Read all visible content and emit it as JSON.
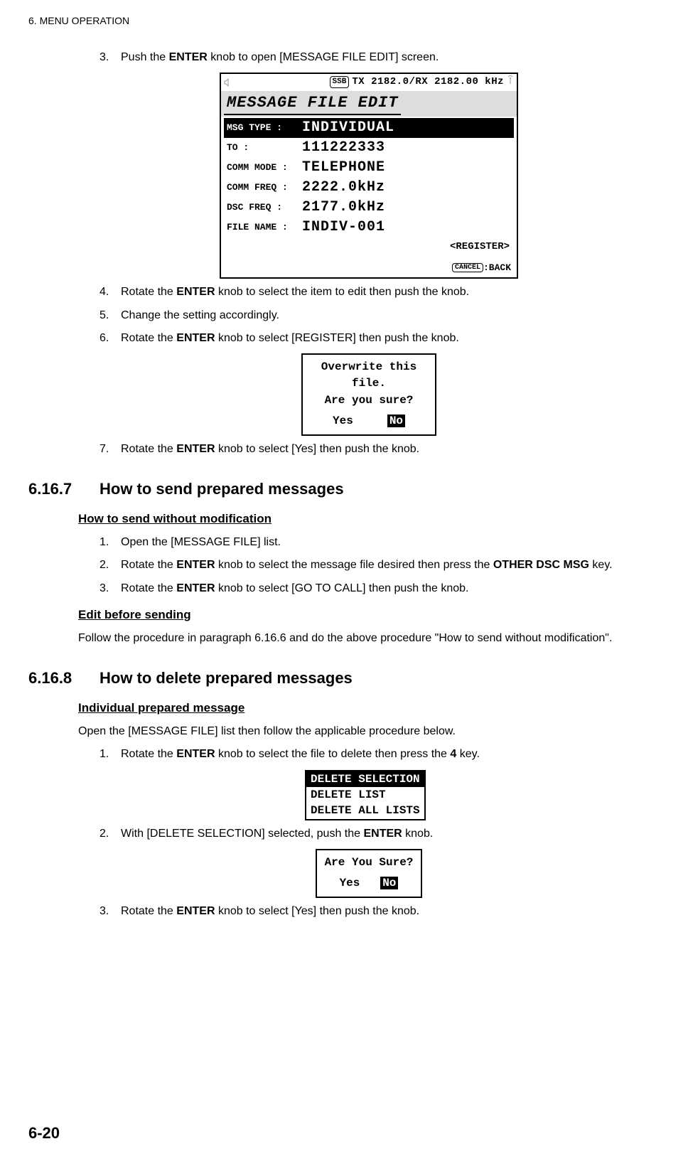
{
  "pageHeader": "6.  MENU OPERATION",
  "step3": {
    "num": "3.",
    "prefix": "Push the ",
    "bold1": "ENTER",
    "suffix": " knob to open [MESSAGE FILE EDIT] screen."
  },
  "screenEdit": {
    "ssb": "SSB",
    "freq": "TX 2182.0/RX 2182.00 kHz",
    "title": "MESSAGE FILE  EDIT",
    "rows": {
      "msgType": {
        "label": "MSG TYPE  :",
        "val": "INDIVIDUAL"
      },
      "to": {
        "label": "TO        :",
        "val": "111222333"
      },
      "commMode": {
        "label": "COMM MODE :",
        "val": "TELEPHONE"
      },
      "commFreq": {
        "label": "COMM FREQ :",
        "val": " 2222.0kHz"
      },
      "dscFreq": {
        "label": "DSC  FREQ :",
        "val": " 2177.0kHz"
      },
      "fileName": {
        "label": "FILE NAME :",
        "val": "INDIV-001"
      }
    },
    "register": "<REGISTER>",
    "cancel": "CANCEL",
    "back": ":BACK"
  },
  "step4": {
    "num": "4.",
    "prefix": "Rotate the ",
    "bold1": "ENTER",
    "suffix": " knob to select the item to edit then push the knob."
  },
  "step5": {
    "num": "5.",
    "text": "Change the setting accordingly."
  },
  "step6": {
    "num": "6.",
    "prefix": "Rotate the ",
    "bold1": "ENTER",
    "suffix": " knob to select [REGISTER] then push the knob."
  },
  "dialog1": {
    "l1": "Overwrite this file.",
    "l2": "Are you sure?",
    "yes": "Yes",
    "no": "No"
  },
  "step7": {
    "num": "7.",
    "prefix": "Rotate the ",
    "bold1": "ENTER",
    "suffix": " knob to select [Yes] then push the knob."
  },
  "section_6_16_7": {
    "num": "6.16.7",
    "title": "How to send prepared messages",
    "sub1": "How to send without modification",
    "s1": {
      "num": "1.",
      "text": "Open the [MESSAGE FILE] list."
    },
    "s2": {
      "num": "2.",
      "prefix": "Rotate the ",
      "bold1": "ENTER",
      "mid": " knob to select the message file desired then press the ",
      "bold2": "OTHER DSC MSG",
      "suffix": " key."
    },
    "s3": {
      "num": "3.",
      "prefix": "Rotate the ",
      "bold1": "ENTER",
      "suffix": " knob to select [GO TO CALL] then push the knob."
    },
    "sub2": "Edit before sending",
    "para": "Follow the procedure in paragraph 6.16.6 and do the above procedure \"How to send without modification\"."
  },
  "section_6_16_8": {
    "num": "6.16.8",
    "title": "How to delete prepared messages",
    "sub1": "Individual prepared message",
    "para": "Open the [MESSAGE FILE] list then follow the applicable procedure below.",
    "s1": {
      "num": "1.",
      "prefix": "Rotate the ",
      "bold1": "ENTER",
      "mid": " knob to select the file to delete then press the ",
      "bold2": "4",
      "suffix": " key."
    },
    "delBox": {
      "l1": "DELETE SELECTION",
      "l2": "DELETE LIST",
      "l3": "DELETE ALL LISTS"
    },
    "s2": {
      "num": "2.",
      "prefix": "With [DELETE SELECTION] selected, push the ",
      "bold1": "ENTER",
      "suffix": " knob."
    },
    "dialog2": {
      "l1": "Are You Sure?",
      "yes": "Yes",
      "no": "No"
    },
    "s3": {
      "num": "3.",
      "prefix": "Rotate the ",
      "bold1": "ENTER",
      "suffix": " knob to select [Yes] then push the knob."
    }
  },
  "pageFooter": "6-20"
}
